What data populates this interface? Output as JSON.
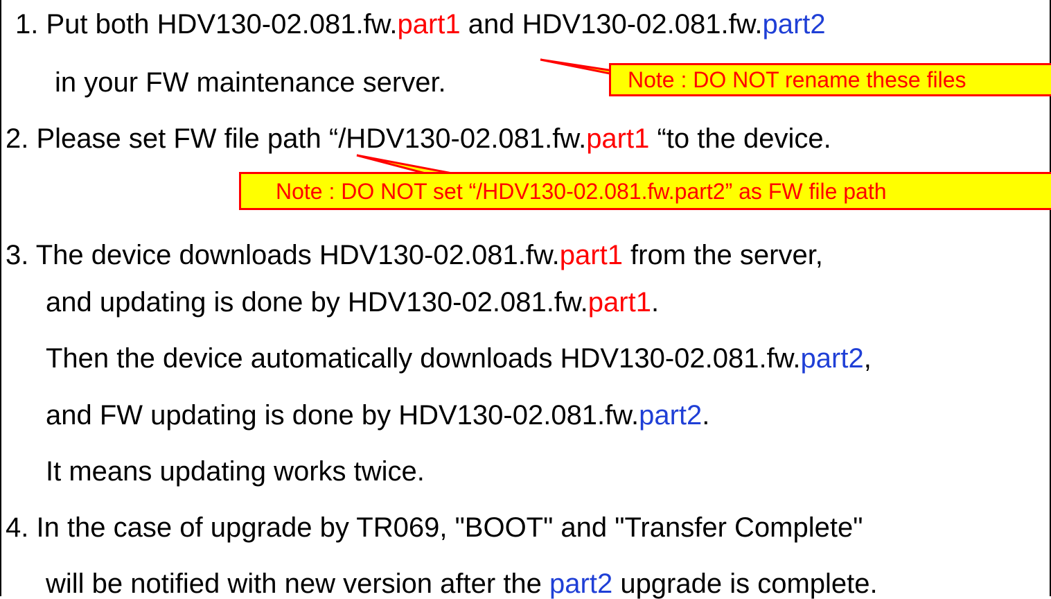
{
  "colors": {
    "red": "#ff0000",
    "blue": "#1f3fd6",
    "note_fill": "#ffff00",
    "note_border": "#ff0000"
  },
  "steps": {
    "s1_line1": {
      "a": "1.  Put both HDV130-02.081.fw.",
      "b": "part1",
      "c": " and HDV130-02.081.fw.",
      "d": "part2"
    },
    "s1_line2": "in your FW maintenance server.",
    "s2_line1": {
      "a": "2. Please set FW file path “/HDV130-02.081.fw.",
      "b": "part1",
      "c": " “to the device."
    },
    "s3_line1": {
      "a": "3. The device downloads HDV130-02.081.fw.",
      "b": "part1",
      "c": " from the server,"
    },
    "s3_line2": {
      "a": "and updating is done by HDV130-02.081.fw.",
      "b": "part1",
      "c": "."
    },
    "s3_line3": {
      "a": "Then the device automatically downloads HDV130-02.081.fw.",
      "b": "part2",
      "c": ","
    },
    "s3_line4": {
      "a": "and FW updating is done by HDV130-02.081.fw.",
      "b": "part2",
      "c": "."
    },
    "s3_line5": "It means updating works twice.",
    "s4_line1": "4. In the case of upgrade by TR069, \"BOOT\" and \"Transfer Complete\"",
    "s4_line2": {
      "a": "will be notified with new version after the ",
      "b": "part2",
      "c": " upgrade is complete."
    }
  },
  "notes": {
    "note1": "Note : DO NOT rename these files",
    "note2": "Note : DO NOT set “/HDV130-02.081.fw.part2” as FW file path"
  }
}
